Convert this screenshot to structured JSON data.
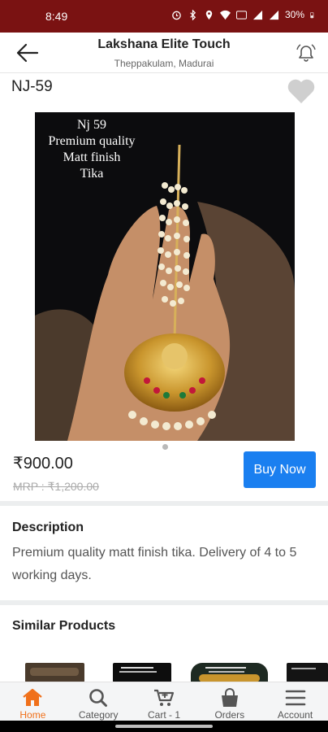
{
  "status_bar": {
    "time": "8:49",
    "battery": "30%"
  },
  "header": {
    "store_name": "Lakshana Elite Touch",
    "location": "Theppakulam, Madurai"
  },
  "product": {
    "code": "NJ-59",
    "image_caption": [
      "Nj 59",
      "Premium quality",
      "Matt finish",
      "Tika"
    ],
    "price": "₹900.00",
    "mrp": "MRP : ₹1,200.00",
    "buy_label": "Buy Now"
  },
  "description": {
    "title": "Description",
    "text": "Premium quality matt finish tika. Delivery of 4 to 5 working days."
  },
  "similar": {
    "title": "Similar Products"
  },
  "bottom_nav": [
    {
      "label": "Home",
      "icon": "home-icon",
      "active": true
    },
    {
      "label": "Category",
      "icon": "search-icon"
    },
    {
      "label": "Cart - 1",
      "icon": "cart-icon"
    },
    {
      "label": "Orders",
      "icon": "bag-icon"
    },
    {
      "label": "Account",
      "icon": "menu-icon"
    }
  ],
  "colors": {
    "status_bar": "#7a1212",
    "buy_button": "#1a7ff0",
    "active_nav": "#f0701a",
    "heart": "#cfcfcf"
  }
}
